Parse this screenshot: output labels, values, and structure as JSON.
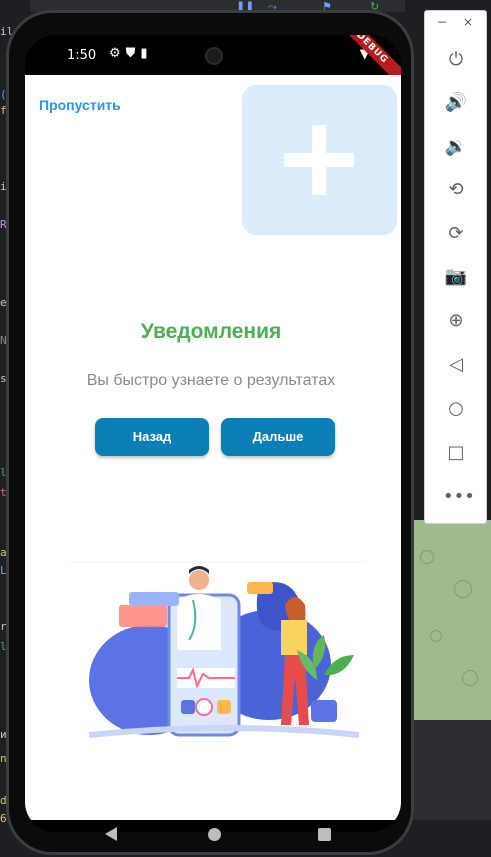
{
  "ide": {
    "tab_fragment": "ild",
    "left_fragments": [
      "(",
      "f",
      "i",
      "R",
      "e",
      "N",
      "s",
      "l",
      "t",
      "a",
      "L",
      "r",
      "l",
      "и",
      "n",
      "d",
      "6"
    ]
  },
  "status_bar": {
    "time": "1:50",
    "debug_label": "DEBUG"
  },
  "onboarding": {
    "skip_label": "Пропустить",
    "title": "Уведомления",
    "subtitle": "Вы быстро узнаете о результатах",
    "back_label": "Назад",
    "next_label": "Дальше"
  },
  "emulator": {
    "minimize_label": "−",
    "close_label": "×",
    "controls": [
      "power-icon",
      "volume-up-icon",
      "volume-down-icon",
      "rotate-left-icon",
      "rotate-right-icon",
      "camera-icon",
      "zoom-icon",
      "back-icon",
      "home-icon",
      "overview-icon",
      "more-icon"
    ]
  },
  "colors": {
    "accent_blue": "#2196f3",
    "title_green": "#4caf50",
    "button_blue": "#0a7fb5"
  }
}
